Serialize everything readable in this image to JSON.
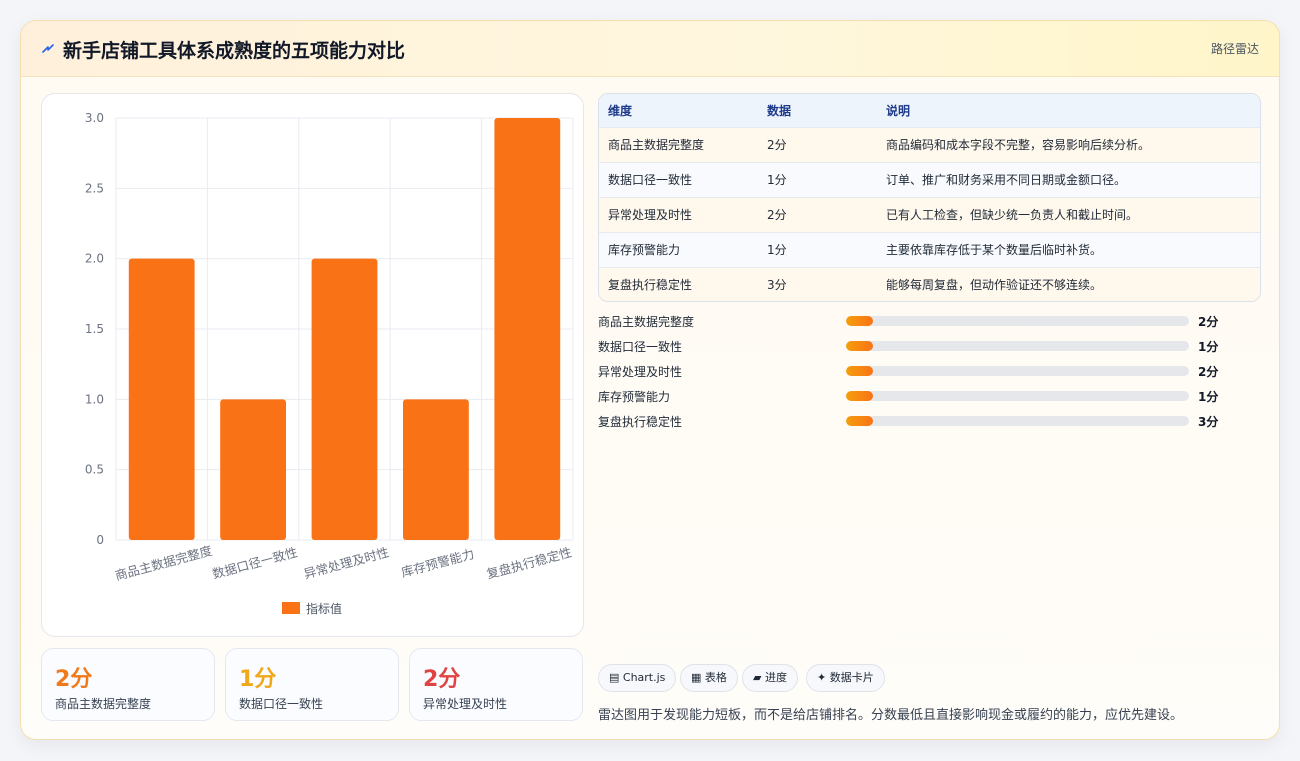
{
  "header": {
    "title": "新手店铺工具体系成熟度的五项能力对比",
    "link": "路径雷达"
  },
  "chart_data": {
    "type": "bar",
    "categories": [
      "商品主数据完整度",
      "数据口径一致性",
      "异常处理及时性",
      "库存预警能力",
      "复盘执行稳定性"
    ],
    "series": [
      {
        "name": "指标值",
        "values": [
          2,
          1,
          2,
          1,
          3
        ]
      }
    ],
    "ylim": [
      0,
      3
    ],
    "yticks": [
      "0",
      "0.5",
      "1.0",
      "1.5",
      "2.0",
      "2.5",
      "3.0"
    ],
    "grid": true,
    "legend": "bottom",
    "bar_color": "#f97316"
  },
  "stats": [
    {
      "value": "2分",
      "label": "商品主数据完整度",
      "color": "#f07a1a"
    },
    {
      "value": "1分",
      "label": "数据口径一致性",
      "color": "#f0a81a"
    },
    {
      "value": "2分",
      "label": "异常处理及时性",
      "color": "#e14242"
    }
  ],
  "table": {
    "headers": [
      "维度",
      "数据",
      "说明"
    ],
    "rows": [
      [
        "商品主数据完整度",
        "2分",
        "商品编码和成本字段不完整，容易影响后续分析。"
      ],
      [
        "数据口径一致性",
        "1分",
        "订单、推广和财务采用不同日期或金额口径。"
      ],
      [
        "异常处理及时性",
        "2分",
        "已有人工检查，但缺少统一负责人和截止时间。"
      ],
      [
        "库存预警能力",
        "1分",
        "主要依靠库存低于某个数量后临时补货。"
      ],
      [
        "复盘执行稳定性",
        "3分",
        "能够每周复盘，但动作验证还不够连续。"
      ]
    ]
  },
  "progress": [
    {
      "label": "商品主数据完整度",
      "value": "2分",
      "fraction": 0.08
    },
    {
      "label": "数据口径一致性",
      "value": "1分",
      "fraction": 0.08
    },
    {
      "label": "异常处理及时性",
      "value": "2分",
      "fraction": 0.08
    },
    {
      "label": "库存预警能力",
      "value": "1分",
      "fraction": 0.08
    },
    {
      "label": "复盘执行稳定性",
      "value": "3分",
      "fraction": 0.08
    }
  ],
  "chips": [
    {
      "icon": "chart-icon",
      "label": "Chart.js"
    },
    {
      "icon": "table-icon",
      "label": "表格"
    },
    {
      "icon": "progress-icon",
      "label": "进度"
    },
    {
      "icon": "card-icon",
      "label": "数据卡片"
    }
  ],
  "footnote": "雷达图用于发现能力短板，而不是给店铺排名。分数最低且直接影响现金或履约的能力，应优先建设。"
}
